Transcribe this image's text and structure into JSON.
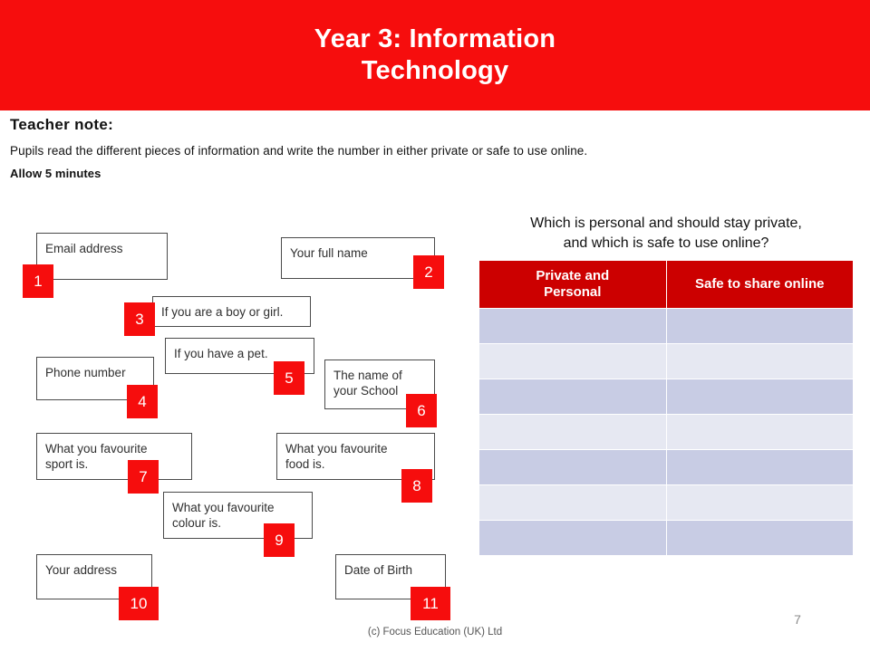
{
  "banner": {
    "title_line1": "Year 3: Information",
    "title_line2": "Technology",
    "background": "#f60d0d"
  },
  "teacher_note": {
    "heading": "Teacher note:",
    "body": "Pupils read the different pieces of information and write the number in either private or safe to use online.",
    "allow": "Allow 5 minutes"
  },
  "question": {
    "line1": "Which is personal and should stay private,",
    "line2": "and which is safe to use online?"
  },
  "table": {
    "headers": [
      "Private and Personal",
      "Safe to share online"
    ],
    "header_col1_line1": "Private and",
    "header_col1_line2": "Personal",
    "header_col2": "Safe to share online",
    "row_count": 7,
    "rows": [
      [
        "",
        ""
      ],
      [
        "",
        ""
      ],
      [
        "",
        ""
      ],
      [
        "",
        ""
      ],
      [
        "",
        ""
      ],
      [
        "",
        ""
      ],
      [
        "",
        ""
      ]
    ],
    "header_background": "#cc0000",
    "band_a_background": "#c8cce4",
    "band_b_background": "#e6e8f2"
  },
  "items": [
    {
      "number": "1",
      "label": "Email address"
    },
    {
      "number": "2",
      "label": "Your full name"
    },
    {
      "number": "3",
      "label": "If you are a boy or girl."
    },
    {
      "number": "4",
      "label": "Phone number"
    },
    {
      "number": "5",
      "label": "If you have a pet."
    },
    {
      "number": "6",
      "label_line1": "The name of",
      "label_line2": "your School",
      "label": "The name of your School"
    },
    {
      "number": "7",
      "label_line1": "What you favourite",
      "label_line2": "sport is.",
      "label": "What you favourite sport is."
    },
    {
      "number": "8",
      "label_line1": "What you favourite",
      "label_line2": "food is.",
      "label": "What you favourite food is."
    },
    {
      "number": "9",
      "label_line1": "What you favourite",
      "label_line2": "colour is.",
      "label": "What you favourite colour is."
    },
    {
      "number": "10",
      "label": "Your address"
    },
    {
      "number": "11",
      "label": "Date of Birth"
    }
  ],
  "footer": {
    "copyright": "(c) Focus Education (UK) Ltd",
    "page_number": "7"
  }
}
